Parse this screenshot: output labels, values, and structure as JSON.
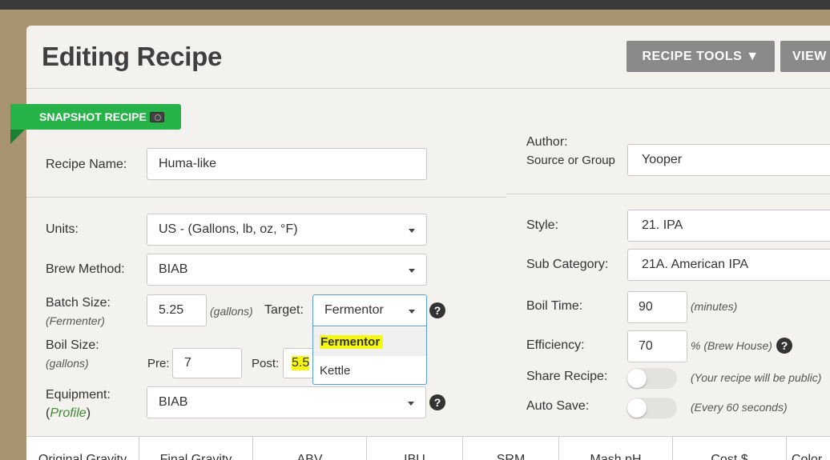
{
  "header": {
    "title": "Editing Recipe",
    "recipe_tools": "RECIPE TOOLS ▼",
    "view": "VIEW"
  },
  "snapshot": {
    "label": "SNAPSHOT RECIPE"
  },
  "left": {
    "recipe_name_label": "Recipe Name:",
    "recipe_name_value": "Huma-like",
    "units_label": "Units:",
    "units_value": "US - (Gallons, lb, oz, °F)",
    "brew_method_label": "Brew Method:",
    "brew_method_value": "BIAB",
    "batch_size_label": "Batch Size:",
    "batch_size_sub": "(Fermenter)",
    "batch_size_value": "5.25",
    "batch_unit": "(gallons)",
    "target_label": "Target:",
    "target_value": "Fermentor",
    "target_options": [
      "Fermentor",
      "Kettle"
    ],
    "boil_size_label": "Boil Size:",
    "boil_size_sub": "(gallons)",
    "pre_label": "Pre:",
    "pre_value": "7",
    "post_label": "Post:",
    "post_value": "5.5",
    "equipment_label": "Equipment:",
    "profile_open": "(",
    "profile_link": "Profile",
    "profile_close": ")",
    "equipment_value": "BIAB"
  },
  "right": {
    "author_label": "Author:",
    "author_sub": "Source or Group",
    "author_value": "Yooper",
    "style_label": "Style:",
    "style_value": "21. IPA",
    "subcat_label": "Sub Category:",
    "subcat_value": "21A. American IPA",
    "boil_time_label": "Boil Time:",
    "boil_time_value": "90",
    "boil_time_unit": "(minutes)",
    "efficiency_label": "Efficiency:",
    "efficiency_value": "70",
    "efficiency_unit": "% (Brew House)",
    "share_label": "Share Recipe:",
    "share_note": "(Your recipe will be public)",
    "autosave_label": "Auto Save:",
    "autosave_note": "(Every 60 seconds)"
  },
  "help_glyph": "?",
  "stats": [
    "Original Gravity",
    "Final Gravity",
    "ABV",
    "IBU",
    "SRM",
    "Mash pH",
    "Cost $",
    "Color"
  ],
  "colors": {
    "snapshot_green": "#27b34a",
    "highlight_yellow": "#f7f714",
    "button_gray": "#8a8a8a"
  }
}
